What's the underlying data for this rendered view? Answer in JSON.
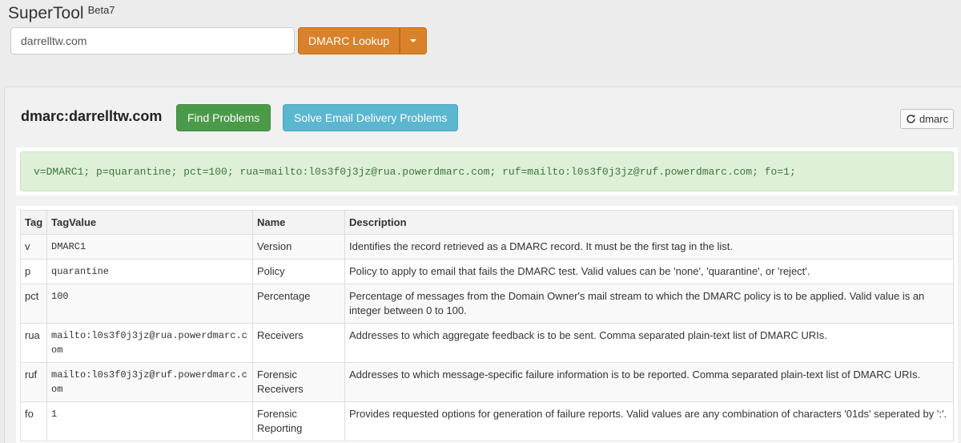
{
  "app": {
    "name": "SuperTool",
    "badge": "Beta7"
  },
  "search": {
    "value": "darrelltw.com",
    "button_label": "DMARC Lookup"
  },
  "panel": {
    "title": "dmarc:darrelltw.com",
    "find_label": "Find Problems",
    "solve_label": "Solve Email Delivery Problems",
    "refresh_label": "dmarc"
  },
  "record": "v=DMARC1; p=quarantine; pct=100; rua=mailto:l0s3f0j3jz@rua.powerdmarc.com; ruf=mailto:l0s3f0j3jz@ruf.powerdmarc.com; fo=1;",
  "table": {
    "headers": [
      "Tag",
      "TagValue",
      "Name",
      "Description"
    ],
    "rows": [
      {
        "tag": "v",
        "value": "DMARC1",
        "name": "Version",
        "description": "Identifies the record retrieved as a DMARC record. It must be the first tag in the list."
      },
      {
        "tag": "p",
        "value": "quarantine",
        "name": "Policy",
        "description": "Policy to apply to email that fails the DMARC test. Valid values can be 'none', 'quarantine', or 'reject'."
      },
      {
        "tag": "pct",
        "value": "100",
        "name": "Percentage",
        "description": "Percentage of messages from the Domain Owner's mail stream to which the DMARC policy is to be applied. Valid value is an integer between 0 to 100."
      },
      {
        "tag": "rua",
        "value": "mailto:l0s3f0j3jz@rua.powerdmarc.com",
        "name": "Receivers",
        "description": "Addresses to which aggregate feedback is to be sent. Comma separated plain-text list of DMARC URIs."
      },
      {
        "tag": "ruf",
        "value": "mailto:l0s3f0j3jz@ruf.powerdmarc.com",
        "name": "Forensic Receivers",
        "description": "Addresses to which message-specific failure information is to be reported. Comma separated plain-text list of DMARC URIs."
      },
      {
        "tag": "fo",
        "value": "1",
        "name": "Forensic Reporting",
        "description": "Provides requested options for generation of failure reports. Valid values are any combination of characters '01ds' seperated by ':'."
      }
    ]
  }
}
